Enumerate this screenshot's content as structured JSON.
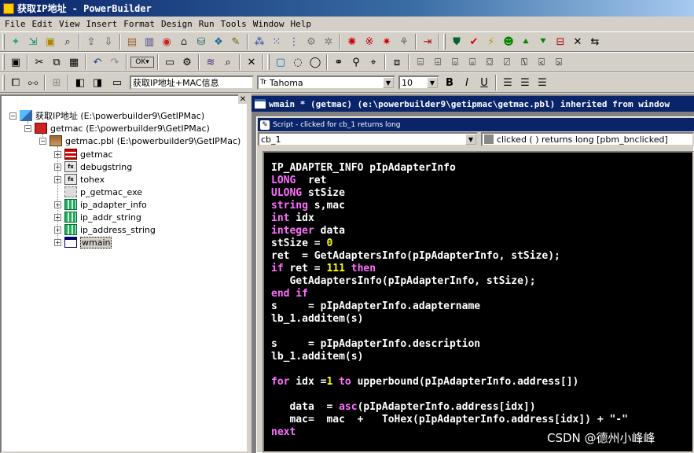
{
  "window": {
    "title": "获取IP地址 - PowerBuilder"
  },
  "menubar": [
    "File",
    "Edit",
    "View",
    "Insert",
    "Format",
    "Design",
    "Run",
    "Tools",
    "Window",
    "Help"
  ],
  "toolbar3": {
    "text_box": "获取IP地址+MAC信息",
    "font_name": "Tahoma",
    "font_prefix": "Tr",
    "font_size": "10",
    "bold": "B",
    "italic": "I",
    "underline": "U"
  },
  "tree": {
    "target": "获取IP地址 (E:\\powerbuilder9\\GetIPMac)",
    "application": "getmac (E:\\powerbuilder9\\GetIPMac)",
    "library": "getmac.pbl (E:\\powerbuilder9\\GetIPMac)",
    "items": [
      {
        "label": "getmac",
        "icon": "menu-icon"
      },
      {
        "label": "debugstring",
        "icon": "function-icon"
      },
      {
        "label": "tohex",
        "icon": "function-icon"
      },
      {
        "label": "p_getmac_exe",
        "icon": "project-icon"
      },
      {
        "label": "ip_adapter_info",
        "icon": "structure-icon"
      },
      {
        "label": "ip_addr_string",
        "icon": "structure-icon"
      },
      {
        "label": "ip_address_string",
        "icon": "structure-icon"
      },
      {
        "label": "wmain",
        "icon": "window-icon"
      }
    ]
  },
  "editor": {
    "mdi_title": "wmain * (getmac) (e:\\powerbuilder9\\getipmac\\getmac.pbl) inherited from window",
    "script_title": "Script - clicked for cb_1 returns long",
    "object_select": "cb_1",
    "event_select": "clicked ( )  returns long [pbm_bnclicked]",
    "code_lines": [
      "IP_ADAPTER_INFO pIpAdapterInfo",
      "LONG  ret",
      "ULONG stSize",
      "string s,mac",
      "int idx",
      "integer data",
      "stSize = 0",
      "ret  = GetAdaptersInfo(pIpAdapterInfo, stSize);",
      "if ret = 111 then",
      "   GetAdaptersInfo(pIpAdapterInfo, stSize);",
      "end if",
      "s     = pIpAdapterInfo.adaptername",
      "lb_1.additem(s)",
      "",
      "s     = pIpAdapterInfo.description",
      "lb_1.additem(s)",
      "",
      "for idx =1 to upperbound(pIpAdapterInfo.address[])",
      "",
      "   data  = asc(pIpAdapterInfo.address[idx])",
      "   mac=  mac  +   ToHex(pIpAdapterInfo.address[idx]) + \"-\"",
      "next"
    ]
  },
  "watermark": "CSDN @德州小峰峰",
  "colors": {
    "code_background": "#000000",
    "code_text": "#ffffff",
    "keyword": "#ff6fff",
    "number": "#ffff00",
    "title_active": "#0a246a"
  }
}
